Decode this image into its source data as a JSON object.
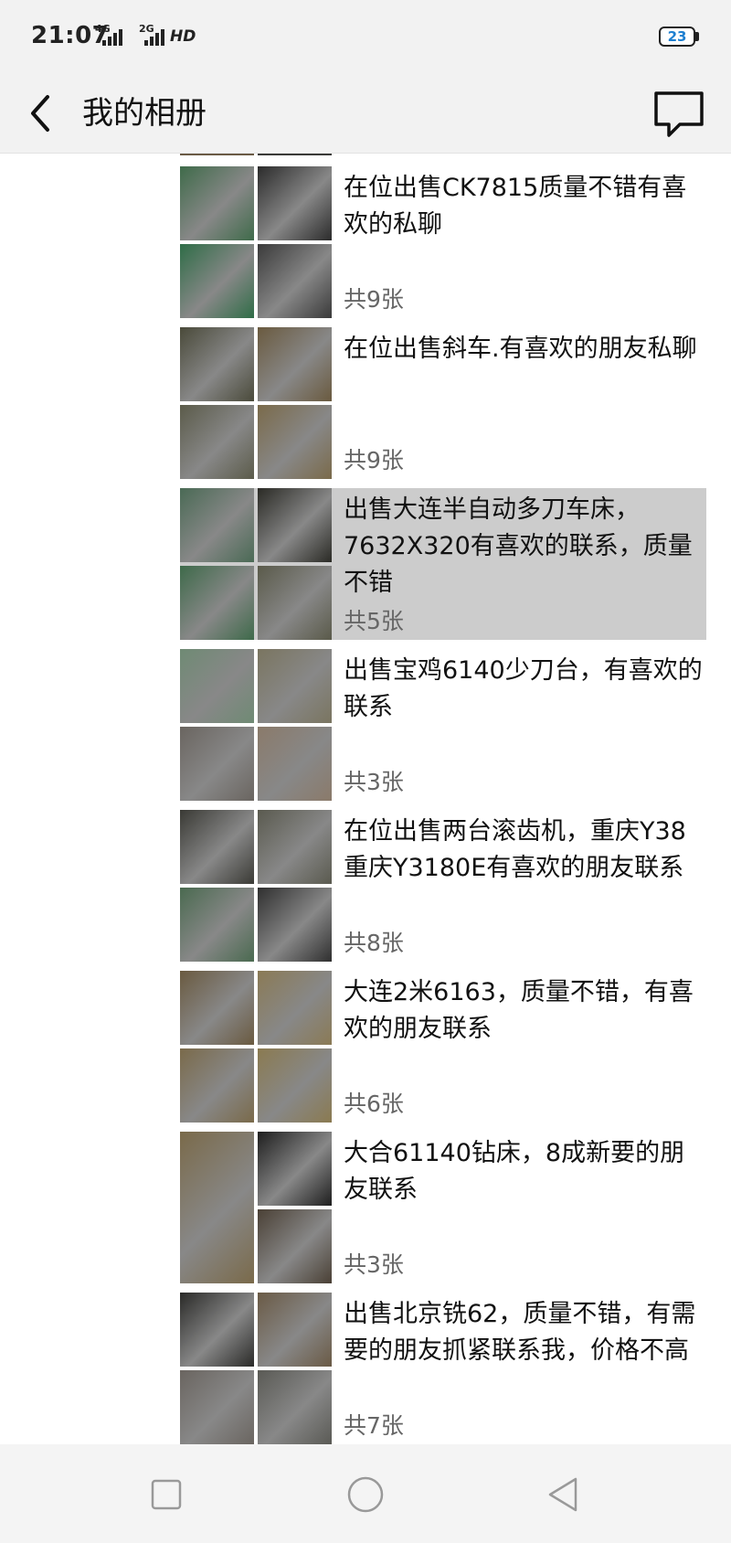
{
  "status_bar": {
    "time": "21:07",
    "net_4g": "4G",
    "net_2g": "2G",
    "hd": "HD",
    "battery": "23"
  },
  "header": {
    "title": "我的相册",
    "back_icon": "chevron-left-icon",
    "message_icon": "chat-bubble-icon"
  },
  "albums": [
    {
      "description": "在位出售CK7815质量不错有喜欢的私聊",
      "count": "共9张",
      "thumbs": [
        "#3f6b4a",
        "#2b2b2b",
        "#2f6d47",
        "#3a3a3a"
      ]
    },
    {
      "description": "在位出售斜车.有喜欢的朋友私聊",
      "count": "共9张",
      "thumbs": [
        "#4a4a3a",
        "#6a5a3f",
        "#5b5b4a",
        "#7a6a4a"
      ]
    },
    {
      "description": "出售大连半自动多刀车床，7632X320有喜欢的联系，质量不错",
      "count": "共5张",
      "selected": true,
      "thumbs": [
        "#4a6a55",
        "#2a2a25",
        "#3e6a4a",
        "#5a5a4a"
      ]
    },
    {
      "description": "出售宝鸡6140少刀台，有喜欢的联系",
      "count": "共3张",
      "thumbs": [
        "#6f8a74",
        "#7a7560",
        "#6a6560",
        "#8a7a6a"
      ]
    },
    {
      "description": "在位出售两台滚齿机，重庆Y38重庆Y3180E有喜欢的朋友联系",
      "count": "共8张",
      "thumbs": [
        "#3a3a35",
        "#5a5a4f",
        "#4a6a50",
        "#2f2f2f"
      ]
    },
    {
      "description": "大连2米6163，质量不错，有喜欢的朋友联系",
      "count": "共6张",
      "thumbs": [
        "#6a5a40",
        "#8a7a55",
        "#7a6a4a",
        "#8a7a50"
      ]
    },
    {
      "description": "大合61140钻床，8成新要的朋友联系",
      "count": "共3张",
      "thumbs": [
        "#7a6a4a",
        "#1e1e1e",
        "#4a4035"
      ],
      "layout": "tall-left"
    },
    {
      "description": "出售北京铣62，质量不错，有需要的朋友抓紧联系我，价格不高",
      "count": "共7张",
      "thumbs": [
        "#2a2a28",
        "#6a5a45",
        "#6a6560",
        "#5a5a55"
      ]
    }
  ],
  "nav": {
    "recent": "square-icon",
    "home": "circle-icon",
    "back": "triangle-back-icon"
  }
}
